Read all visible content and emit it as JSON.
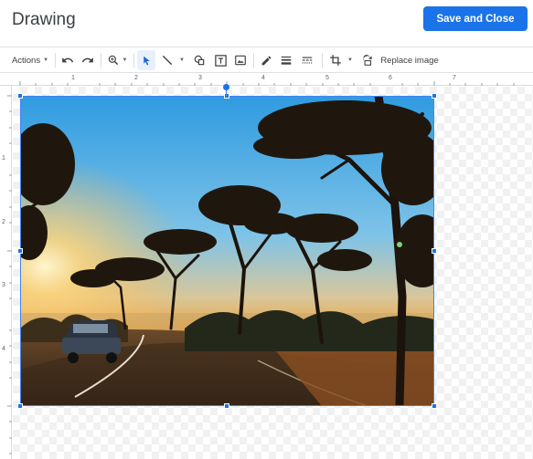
{
  "header": {
    "title": "Drawing",
    "save_label": "Save and Close"
  },
  "toolbar": {
    "actions_label": "Actions",
    "replace_image_label": "Replace image"
  },
  "ruler": {
    "top_numbers": [
      "1",
      "2",
      "3",
      "4",
      "5",
      "6",
      "7"
    ],
    "left_numbers": [
      "1",
      "2",
      "3",
      "4"
    ]
  },
  "colors": {
    "accent": "#1a73e8",
    "selection": "#4285f4"
  },
  "icons": [
    "undo-icon",
    "redo-icon",
    "zoom-icon",
    "select-icon",
    "line-icon",
    "shape-icon",
    "textbox-icon",
    "image-icon",
    "pen-icon",
    "line-weight-icon",
    "line-dash-icon",
    "crop-icon",
    "reset-image-icon"
  ]
}
